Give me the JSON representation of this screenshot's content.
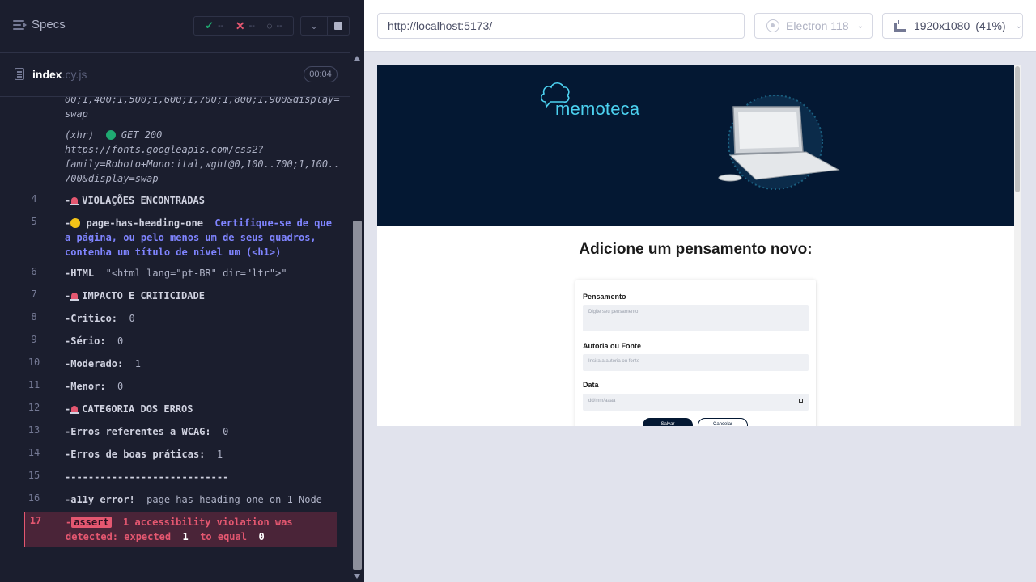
{
  "reporter": {
    "specs_label": "Specs",
    "stats": {
      "passed": "--",
      "failed": "--",
      "pending": "--"
    },
    "spec": {
      "name": "index",
      "ext": ".cy.js",
      "time": "00:04"
    }
  },
  "log": {
    "line_a": "00;1,400;1,500;1,600;1,700;1,800;1,900&display=",
    "line_b": "swap",
    "xhr_tag": "(xhr)",
    "xhr_status": "GET 200",
    "xhr_url_1": "https://fonts.googleapis.com/css2?",
    "xhr_url_2": "family=Roboto+Mono:ital,wght@0,100..700;1,100..",
    "xhr_url_3": "700&display=swap",
    "commands": [
      {
        "num": "4",
        "text": "VIOLAÇÕES ENCONTRADAS"
      },
      {
        "num": "5",
        "text": "page-has-heading-one",
        "msg": "Certifique-se de que a página, ou pelo menos um de seus quadros, contenha um título de nível um (<h1>)"
      },
      {
        "num": "6",
        "text": "HTML",
        "value": "\"<html lang=\"pt-BR\" dir=\"ltr\">\""
      },
      {
        "num": "7",
        "text": "IMPACTO E CRITICIDADE"
      },
      {
        "num": "8",
        "text": "Crítico:",
        "value": "0"
      },
      {
        "num": "9",
        "text": "Sério:",
        "value": "0"
      },
      {
        "num": "10",
        "text": "Moderado:",
        "value": "1"
      },
      {
        "num": "11",
        "text": "Menor:",
        "value": "0"
      },
      {
        "num": "12",
        "text": "CATEGORIA DOS ERROS"
      },
      {
        "num": "13",
        "text": "Erros referentes a WCAG:",
        "value": "0"
      },
      {
        "num": "14",
        "text": "Erros de boas práticas:",
        "value": "1"
      },
      {
        "num": "15",
        "text": "---------------------------"
      },
      {
        "num": "16",
        "text": "a11y error!",
        "value": "page-has-heading-one on 1 Node"
      },
      {
        "num": "17",
        "tag": "assert",
        "msg_1": "1 accessibility violation was",
        "msg_2": "detected: expected",
        "expected": "1",
        "msg_3": "to equal",
        "actual": "0"
      }
    ]
  },
  "aut": {
    "url": "http://localhost:5173/",
    "browser": "Electron 118",
    "viewport": "1920x1080",
    "zoom": "(41%)"
  },
  "app": {
    "logo_text": "memoteca",
    "heading": "Adicione um pensamento novo:",
    "form": {
      "thought_label": "Pensamento",
      "thought_placeholder": "Digite seu pensamento",
      "author_label": "Autoria ou Fonte",
      "author_placeholder": "Insira a autoria ou fonte",
      "date_label": "Data",
      "date_placeholder": "dd/mm/aaaa",
      "save": "Salvar",
      "cancel": "Cancelar"
    }
  },
  "colors": {
    "reporter_bg": "#1b1e2e",
    "accent_blue": "#7f84ff",
    "fail_red": "#e45770",
    "pass_green": "#1fa971",
    "app_navy": "#041833",
    "app_cyan": "#4cd1f0"
  },
  "icons": [
    "menu-icon",
    "check-icon",
    "x-icon",
    "spinner-icon",
    "chevron-down-icon",
    "stop-icon",
    "document-icon",
    "electron-icon",
    "ruler-icon",
    "cloud-logo-icon",
    "laptop-image"
  ]
}
